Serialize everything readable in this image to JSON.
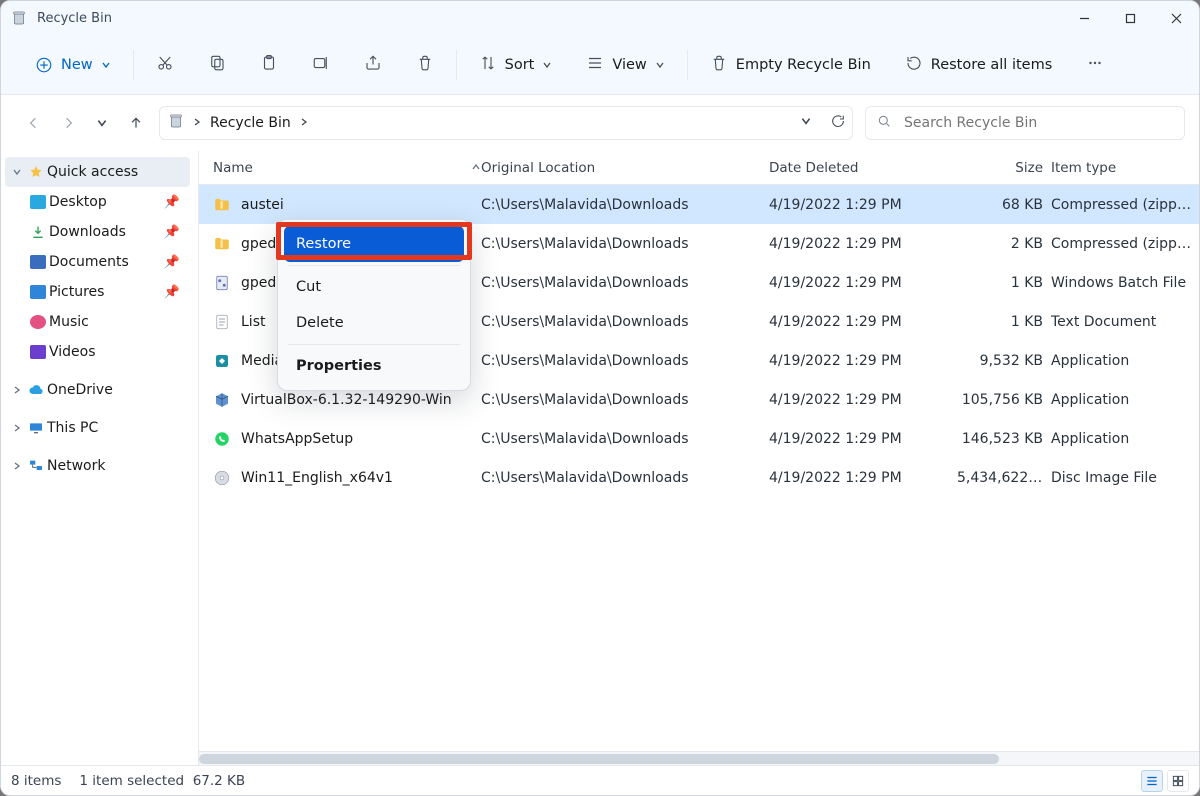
{
  "window": {
    "title": "Recycle Bin"
  },
  "toolbar": {
    "new_label": "New",
    "sort_label": "Sort",
    "view_label": "View",
    "empty_label": "Empty Recycle Bin",
    "restore_all_label": "Restore all items"
  },
  "address": {
    "crumb": "Recycle Bin"
  },
  "search": {
    "placeholder": "Search Recycle Bin"
  },
  "sidebar": {
    "quick_access": "Quick access",
    "items": [
      {
        "label": "Desktop"
      },
      {
        "label": "Downloads"
      },
      {
        "label": "Documents"
      },
      {
        "label": "Pictures"
      },
      {
        "label": "Music"
      },
      {
        "label": "Videos"
      }
    ],
    "onedrive": "OneDrive",
    "this_pc": "This PC",
    "network": "Network"
  },
  "columns": {
    "name": "Name",
    "location": "Original Location",
    "date": "Date Deleted",
    "size": "Size",
    "type": "Item type"
  },
  "files": [
    {
      "name": "austei",
      "icon": "zip",
      "location": "C:\\Users\\Malavida\\Downloads",
      "date": "4/19/2022 1:29 PM",
      "size": "68 KB",
      "type": "Compressed (zipp…"
    },
    {
      "name": "gpedi",
      "icon": "zip",
      "location": "C:\\Users\\Malavida\\Downloads",
      "date": "4/19/2022 1:29 PM",
      "size": "2 KB",
      "type": "Compressed (zipp…"
    },
    {
      "name": "gpedi",
      "icon": "bat",
      "location": "C:\\Users\\Malavida\\Downloads",
      "date": "4/19/2022 1:29 PM",
      "size": "1 KB",
      "type": "Windows Batch File"
    },
    {
      "name": "List",
      "icon": "txt",
      "location": "C:\\Users\\Malavida\\Downloads",
      "date": "4/19/2022 1:29 PM",
      "size": "1 KB",
      "type": "Text Document"
    },
    {
      "name": "MediaCreationToolW11",
      "icon": "tool",
      "location": "C:\\Users\\Malavida\\Downloads",
      "date": "4/19/2022 1:29 PM",
      "size": "9,532 KB",
      "type": "Application"
    },
    {
      "name": "VirtualBox-6.1.32-149290-Win",
      "icon": "vbox",
      "location": "C:\\Users\\Malavida\\Downloads",
      "date": "4/19/2022 1:29 PM",
      "size": "105,756 KB",
      "type": "Application"
    },
    {
      "name": "WhatsAppSetup",
      "icon": "wa",
      "location": "C:\\Users\\Malavida\\Downloads",
      "date": "4/19/2022 1:29 PM",
      "size": "146,523 KB",
      "type": "Application"
    },
    {
      "name": "Win11_English_x64v1",
      "icon": "iso",
      "location": "C:\\Users\\Malavida\\Downloads",
      "date": "4/19/2022 1:29 PM",
      "size": "5,434,622 …",
      "type": "Disc Image File"
    }
  ],
  "context_menu": {
    "restore": "Restore",
    "cut": "Cut",
    "delete": "Delete",
    "properties": "Properties"
  },
  "status": {
    "count": "8 items",
    "selection": "1 item selected",
    "size": "67.2 KB"
  }
}
